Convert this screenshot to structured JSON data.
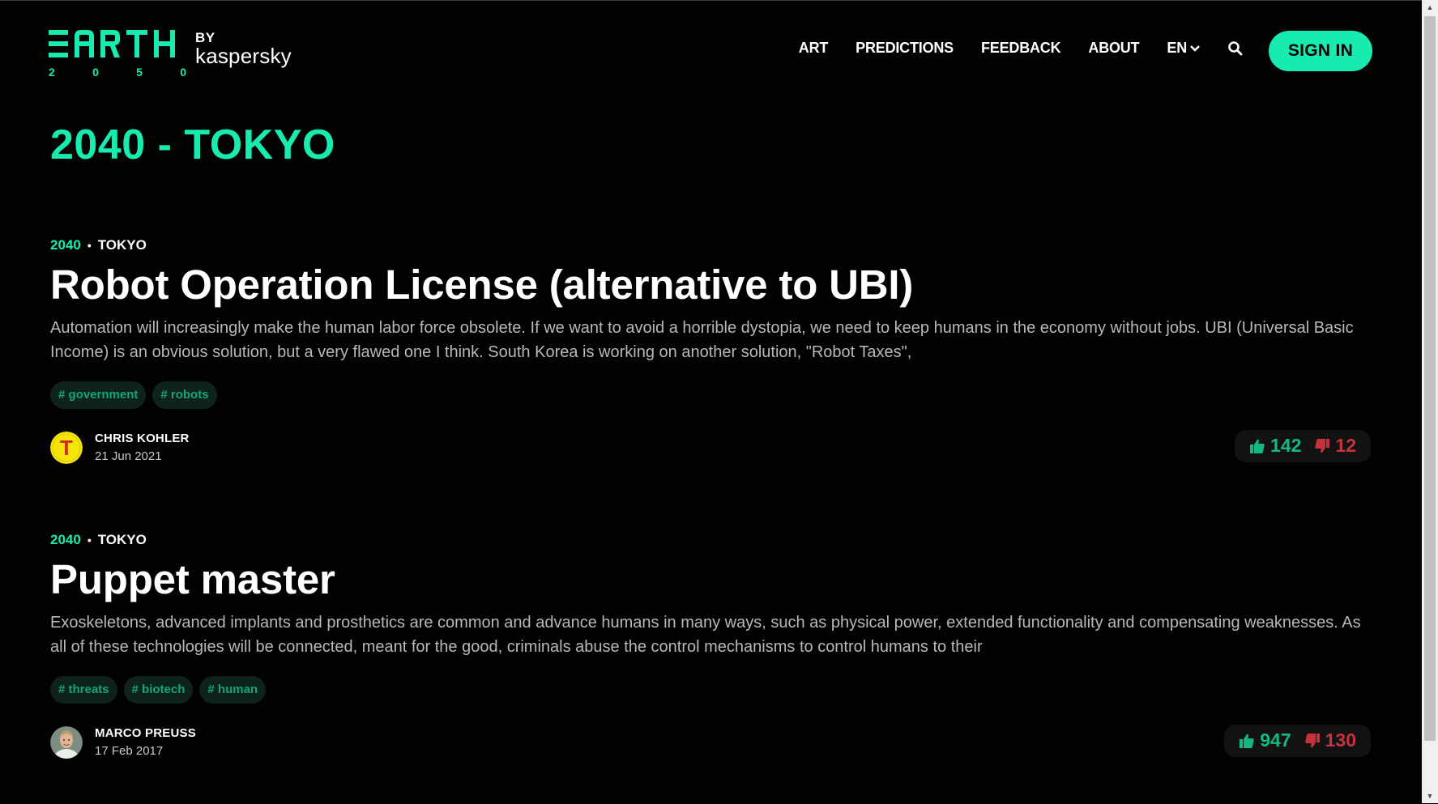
{
  "brand": {
    "logo_text": "EARTH",
    "by": "BY",
    "kaspersky": "kaspersky",
    "year_digits": [
      "2",
      "0",
      "5",
      "0"
    ]
  },
  "nav": {
    "items": [
      "ART",
      "PREDICTIONS",
      "FEEDBACK",
      "ABOUT"
    ],
    "language": "EN",
    "sign_in": "SIGN IN"
  },
  "page": {
    "title": "2040 - TOKYO"
  },
  "posts": [
    {
      "year": "2040",
      "city": "TOKYO",
      "title": "Robot Operation License (alternative to UBI)",
      "excerpt": "Automation will increasingly make the human labor force obsolete. If we want to avoid a horrible dystopia, we need to keep humans in the economy without jobs. UBI (Universal Basic Income) is an obvious solution, but a very flawed one I think. South Korea is working on another solution, \"Robot Taxes\",",
      "tags": [
        "# government",
        "# robots"
      ],
      "author": "CHRIS KOHLER",
      "date": "21 Jun 2021",
      "avatar_letter": "T",
      "likes": "142",
      "dislikes": "12"
    },
    {
      "year": "2040",
      "city": "TOKYO",
      "title": "Puppet master",
      "excerpt": "Exoskeletons, advanced implants and prosthetics are common and advance humans in many ways, such as physical power, extended functionality and compensating weaknesses. As all of these technologies will be connected, meant for the good, criminals abuse the control mechanisms to control humans to their",
      "tags": [
        "# threats",
        "# biotech",
        "# human"
      ],
      "author": "MARCO PREUSS",
      "date": "17 Feb 2017",
      "likes": "947",
      "dislikes": "130"
    }
  ],
  "icons": {
    "search": "search-icon",
    "chevron": "chevron-down-icon",
    "like": "thumbs-up-icon",
    "dislike": "thumbs-down-icon"
  },
  "colors": {
    "accent": "#17ebb0",
    "background": "#020202",
    "like": "#14b885",
    "dislike": "#c8323c",
    "tag_bg": "#0d231c",
    "tag_text": "#11a67a"
  }
}
